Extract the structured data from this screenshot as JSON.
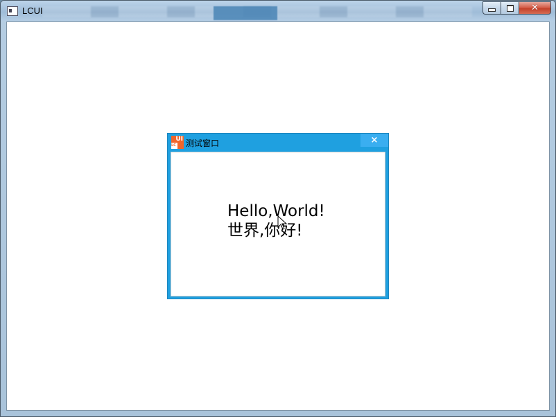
{
  "window": {
    "title": "LCUI",
    "controls": {
      "minimize_icon": "minimize-icon",
      "maximize_icon": "maximize-icon",
      "close_glyph": "✕"
    }
  },
  "dialog": {
    "title": "测试窗口",
    "icon": "lcui-logo-icon",
    "icon_text": "UI",
    "close_glyph": "×",
    "accent_color": "#1fa0e0",
    "content": {
      "line1": "Hello,World!",
      "line2": "世界,你好!"
    }
  }
}
